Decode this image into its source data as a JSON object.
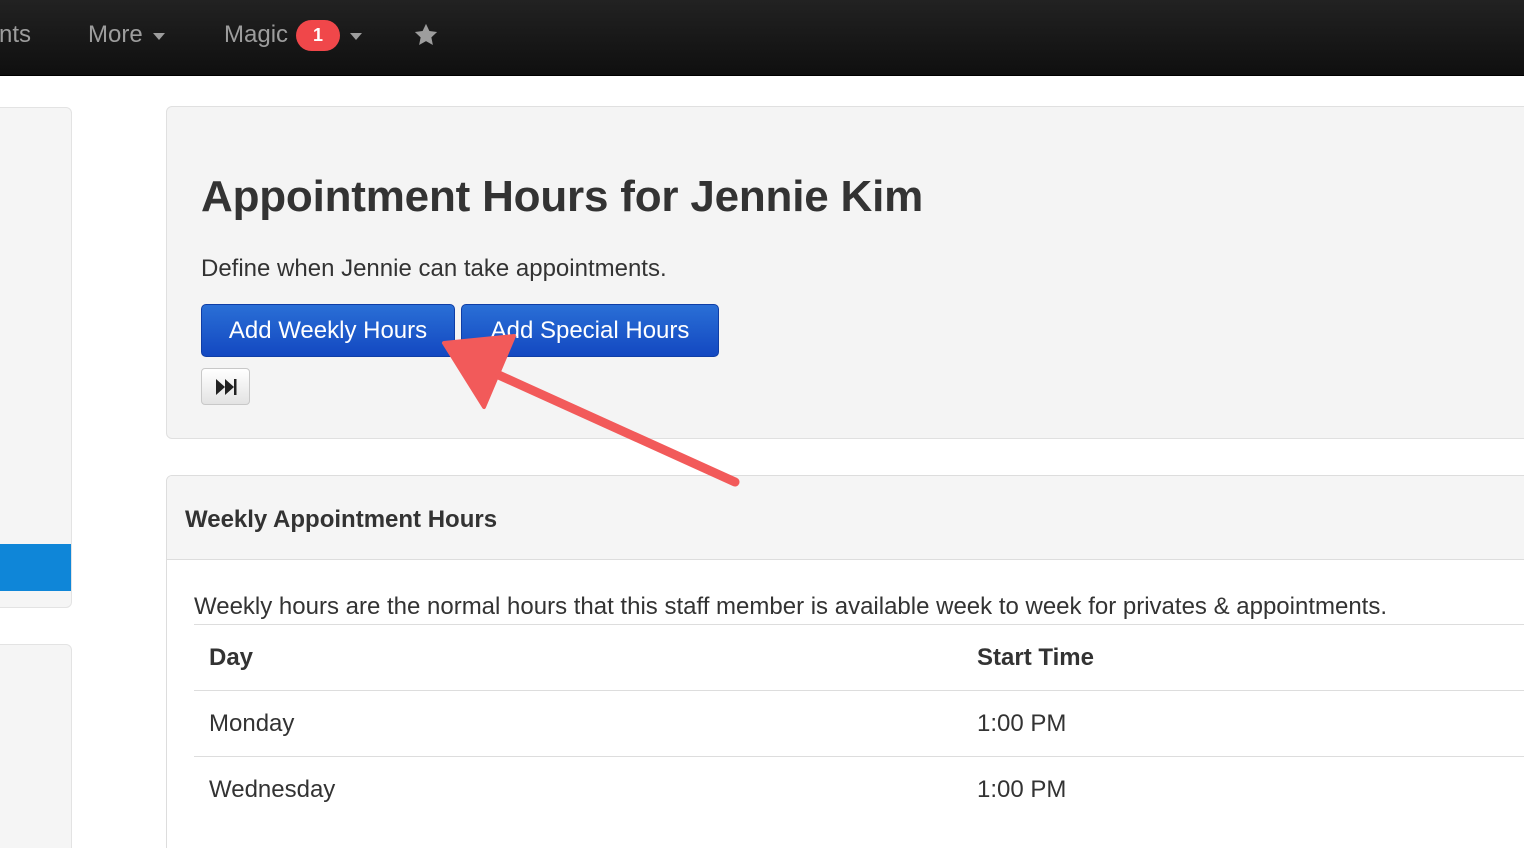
{
  "navbar": {
    "partial_item": "nts",
    "more_label": "More",
    "magic_label": "Magic",
    "magic_badge": "1",
    "star_icon": "star-icon"
  },
  "hero": {
    "title": "Appointment Hours for Jennie Kim",
    "description": "Define when Jennie can take appointments.",
    "add_weekly_label": "Add Weekly Hours",
    "add_special_label": "Add Special Hours",
    "forward_icon": "fast-forward-icon"
  },
  "weekly_panel": {
    "title": "Weekly Appointment Hours",
    "description": "Weekly hours are the normal hours that this staff member is available week to week for privates & appointments.",
    "columns": [
      "Day",
      "Start Time"
    ],
    "rows": [
      {
        "day": "Monday",
        "start": "1:00 PM"
      },
      {
        "day": "Wednesday",
        "start": "1:00 PM"
      }
    ]
  },
  "colors": {
    "navbar_bg": "#111111",
    "primary_button": "#1a55cc",
    "badge": "#f0474a",
    "sidebar_active": "#0f86d8",
    "annotation_arrow": "#f25a5a"
  }
}
